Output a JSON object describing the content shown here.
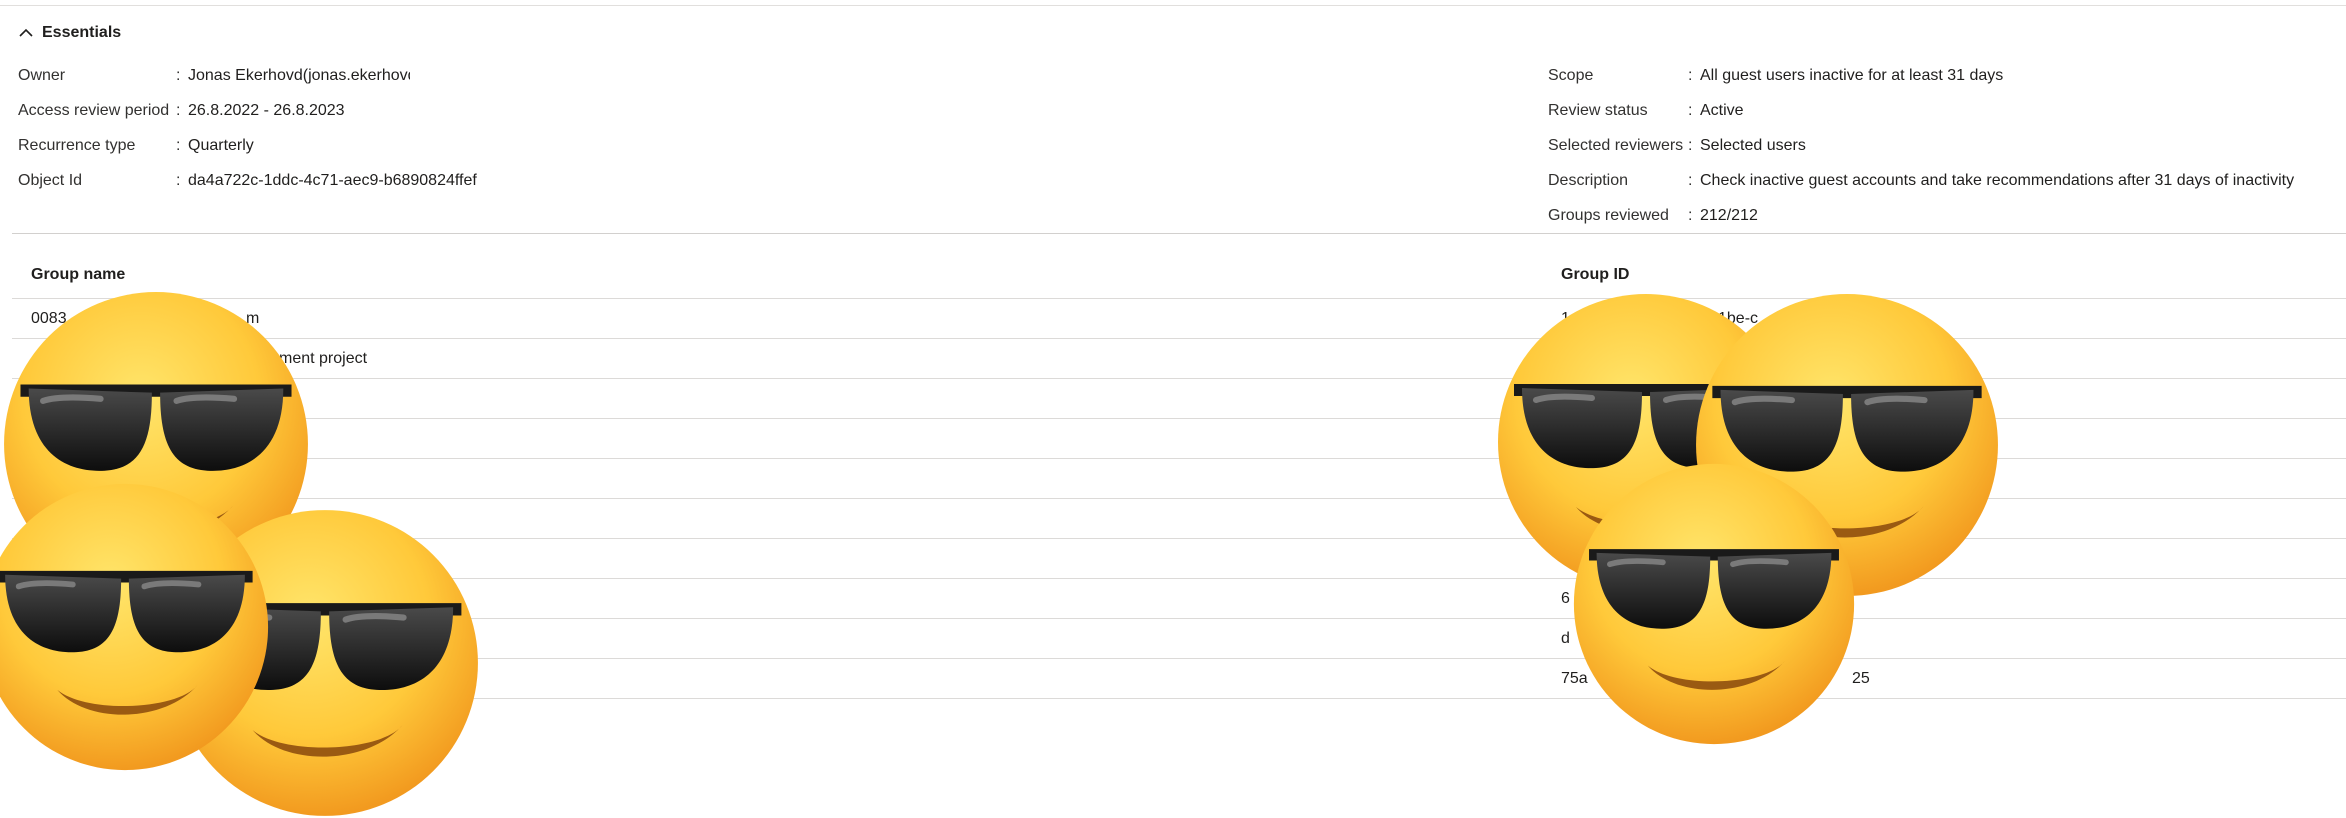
{
  "essentials": {
    "toggle_label": "Essentials",
    "left": [
      {
        "label": "Owner",
        "value": "Jonas Ekerhovd(jonas.ekerhovd"
      },
      {
        "label": "Access review period",
        "value": "26.8.2022 - 26.8.2023"
      },
      {
        "label": "Recurrence type",
        "value": "Quarterly"
      },
      {
        "label": "Object Id",
        "value": "da4a722c-1ddc-4c71-aec9-b6890824ffef"
      }
    ],
    "right": [
      {
        "label": "Scope",
        "value": "All guest users inactive for at least 31 days"
      },
      {
        "label": "Review status",
        "value": "Active"
      },
      {
        "label": "Selected reviewers",
        "value": "Selected users"
      },
      {
        "label": "Description",
        "value": "Check inactive guest accounts and take recommendations after 31 days of inactivity"
      },
      {
        "label": "Groups reviewed",
        "value": "212/212"
      }
    ]
  },
  "table": {
    "columns": [
      "Group name",
      "Group ID"
    ],
    "rows": [
      {
        "name": "0083",
        "name_tail": "m",
        "id": "1",
        "id_tail": "1be-c"
      },
      {
        "name": "",
        "name_tail": "ment project",
        "id": "",
        "id_tail": ""
      },
      {
        "name": "",
        "name_tail": "",
        "id": "",
        "id_tail": ""
      },
      {
        "name": "",
        "name_tail": "",
        "id": "",
        "id_tail": ""
      },
      {
        "name": "",
        "name_tail": "",
        "id": "",
        "id_tail": ""
      },
      {
        "name": "",
        "name_tail": "",
        "id": "",
        "id_tail": ""
      },
      {
        "name": "",
        "name_tail": "",
        "id": "",
        "id_tail": ""
      },
      {
        "name": "",
        "name_tail": "",
        "id": "6",
        "id_tail": ""
      },
      {
        "name": "",
        "name_tail": "",
        "id": "d",
        "id_tail": ""
      },
      {
        "name": "",
        "name_tail": "",
        "id": "75a",
        "id_tail": "25"
      }
    ]
  },
  "overlay": {
    "emoji_icon": "smiling-face-with-sunglasses-icon",
    "colors": {
      "face": "#ffc93a",
      "face_edge": "#f29a1f",
      "glasses": "#1a1a1a",
      "smile": "#9a5a12"
    }
  }
}
